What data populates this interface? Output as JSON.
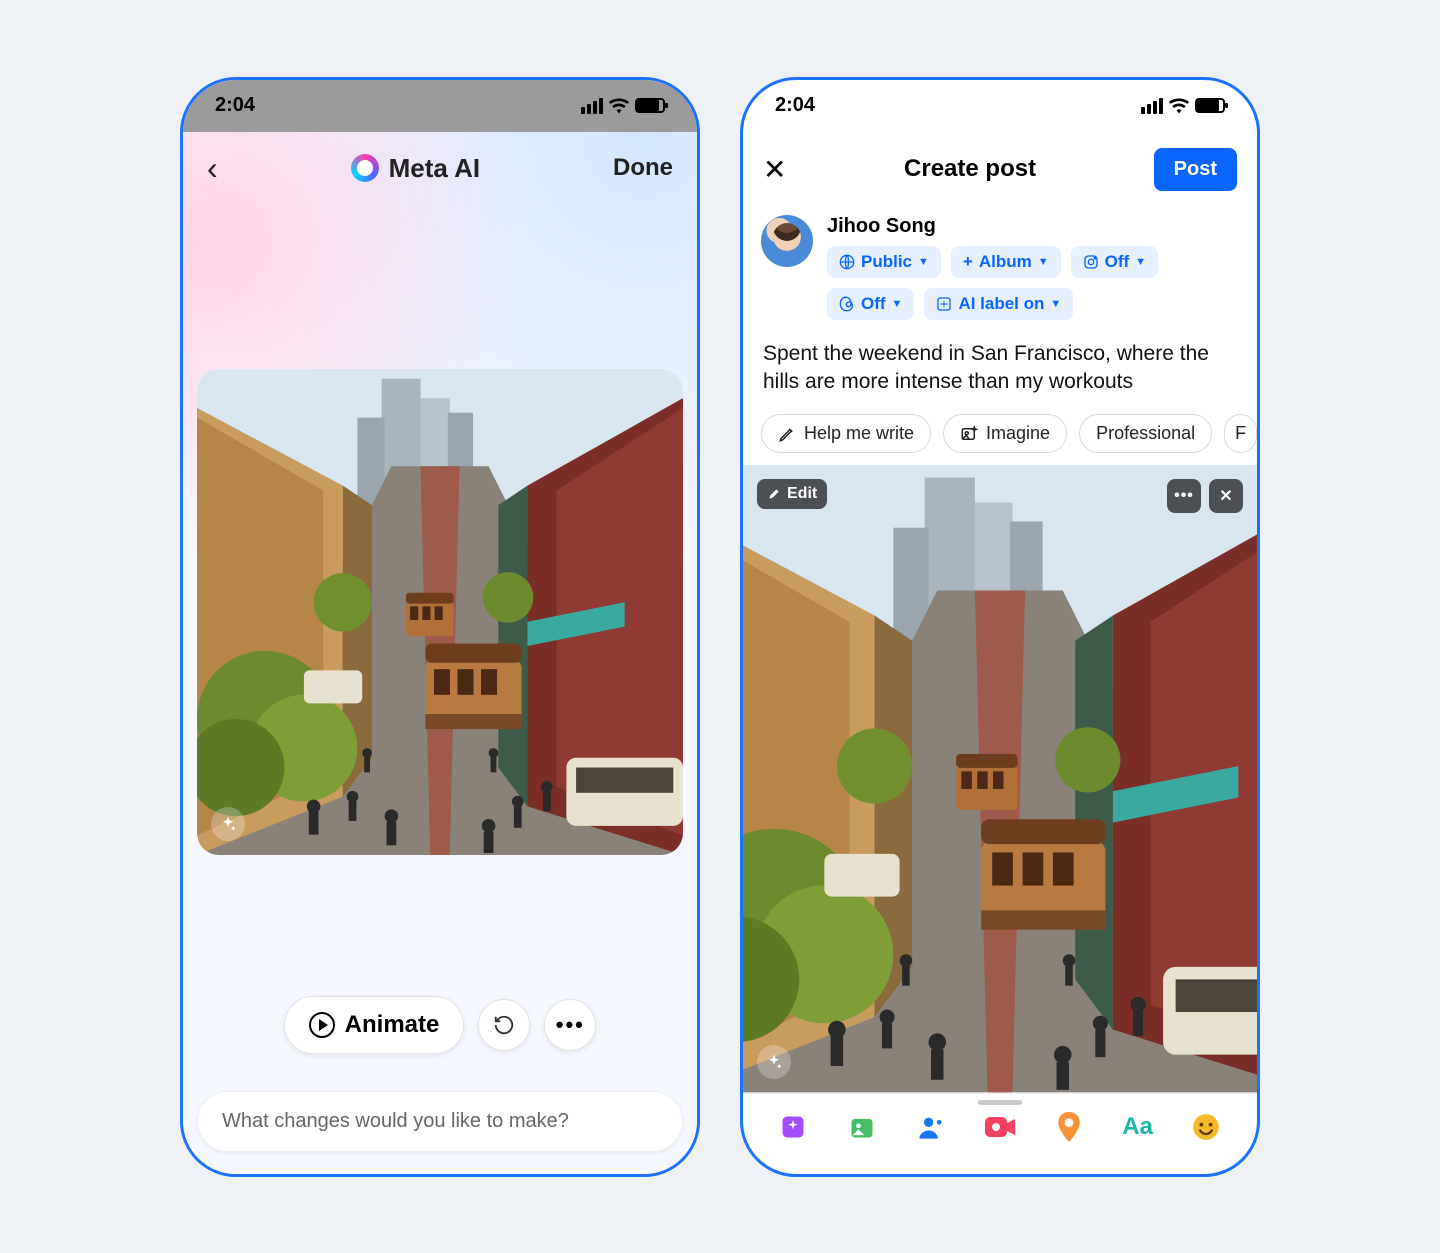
{
  "status": {
    "time": "2:04"
  },
  "left": {
    "title": "Meta AI",
    "back_aria": "Back",
    "done": "Done",
    "animate": "Animate",
    "prompt_placeholder": "What changes would you like to make?"
  },
  "right": {
    "close_aria": "Close",
    "title": "Create post",
    "post_btn": "Post",
    "user_name": "Jihoo Song",
    "chips": {
      "audience": "Public",
      "album": "Album",
      "instagram": "Off",
      "threads": "Off",
      "ai_label": "AI label on"
    },
    "caption": "Spent the weekend in San Francisco, where the hills are more intense than my workouts",
    "suggestions": {
      "help": "Help me write",
      "imagine": "Imagine",
      "professional": "Professional"
    },
    "edit_btn": "Edit",
    "text_format_label": "Aa"
  }
}
